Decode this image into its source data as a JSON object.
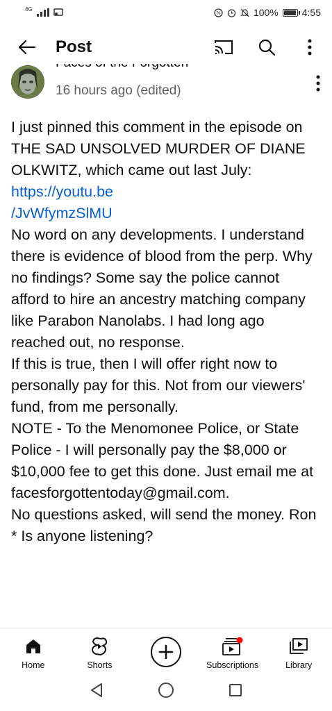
{
  "status_bar": {
    "network": "4G",
    "battery_text": "100%",
    "battery_level": 1.0,
    "time": "4:55"
  },
  "header": {
    "title": "Post"
  },
  "comment": {
    "author": "Faces of the Forgotten",
    "meta": "16 hours ago (edited)",
    "body_before_link": "I just pinned this comment in the episode on THE SAD UNSOLVED MURDER OF DIANE OLKWITZ, which came out last July: ",
    "link_text": "https://youtu.be\n/JvWfymzSlMU",
    "body_after_link": "\nNo word on any developments. I understand there is evidence of blood from the perp. Why no findings? Some say the police cannot afford to hire an ancestry matching company like Parabon Nanolabs. I had long ago reached out, no response.\nIf this is true, then I will offer right now to personally pay for this. Not from our viewers' fund, from me personally.\nNOTE - To the Menomonee Police, or State Police - I will personally pay the $8,000 or $10,000 fee to get this done. Just email me at facesforgottentoday@gmail.com.\nNo questions asked, will send the money. Ron\n* Is anyone listening?"
  },
  "bottom_nav": {
    "items": [
      {
        "label": "Home",
        "icon": "home-icon"
      },
      {
        "label": "Shorts",
        "icon": "shorts-icon"
      },
      {
        "label": "",
        "icon": "create-icon"
      },
      {
        "label": "Subscriptions",
        "icon": "subscriptions-icon"
      },
      {
        "label": "Library",
        "icon": "library-icon"
      }
    ]
  },
  "colors": {
    "link": "#065fd4",
    "notification_dot": "#ff0000",
    "meta_text": "#606060"
  }
}
